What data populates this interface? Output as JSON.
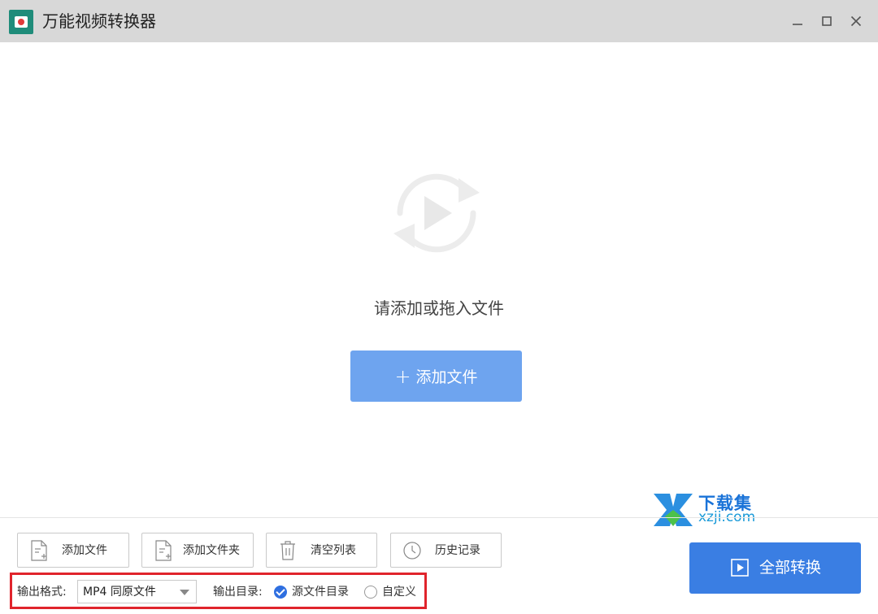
{
  "window": {
    "title": "万能视频转换器"
  },
  "main": {
    "hint": "请添加或拖入文件",
    "add_file_button": "添加文件"
  },
  "watermark": {
    "name": "下载集",
    "domain": "xzji.com"
  },
  "toolbar": {
    "add_file": "添加文件",
    "add_folder": "添加文件夹",
    "clear_list": "清空列表",
    "history": "历史记录"
  },
  "output": {
    "format_label": "输出格式:",
    "format_value": "MP4 同原文件",
    "dir_label": "输出目录:",
    "dir_options": [
      "源文件目录",
      "自定义"
    ],
    "dir_selected": "源文件目录"
  },
  "convert_all": "全部转换",
  "colors": {
    "accent": "#3a7ee3",
    "add_button": "#6ea4ef",
    "highlight": "#e0242c",
    "titlebar": "#d8d8d8"
  }
}
